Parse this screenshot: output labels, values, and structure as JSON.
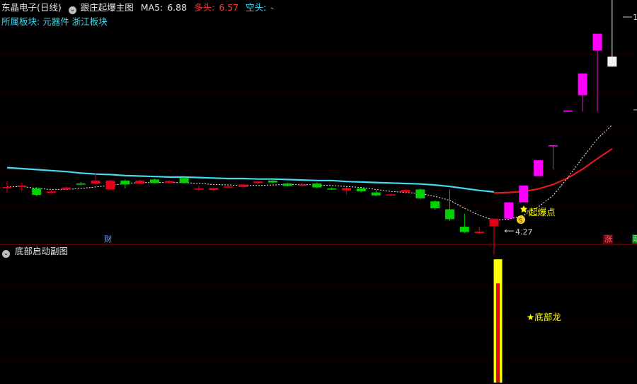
{
  "header": {
    "stock_name": "东晶电子(日线)",
    "indicator_name": "跟庄起爆主图",
    "ma5_label": "MA5:",
    "ma5_value": "6.88",
    "bull_label": "多头:",
    "bull_value": "6.57",
    "bear_label": "空头:",
    "bear_value": "-",
    "sector_label": "所属板块:",
    "sectors": "元器件 浙江板块"
  },
  "sub_panel": {
    "title": "底部启动副图",
    "signal_label": "★底部龙"
  },
  "markers": {
    "cai": "财",
    "zhang": "涨",
    "edge": "融",
    "low_price": "4.27",
    "qibao_label": "起爆点",
    "qibao_icon": "S",
    "top_price": "1"
  },
  "colors": {
    "up": "#e4001c",
    "down": "#00d200",
    "boom": "#ff00ff",
    "cyan_line": "#44d9ec",
    "red_line": "#e31919",
    "grid": "#5a0000",
    "text_white": "#e6e6e6",
    "text_red": "#ff3232",
    "text_cyan": "#3cdcf0",
    "text_yellow": "#ffff00"
  },
  "chart_data": {
    "type": "candlestick",
    "title": "跟庄起爆主图",
    "candles": [
      {
        "o": 5.62,
        "h": 5.75,
        "l": 5.52,
        "c": 5.63,
        "kind": "up"
      },
      {
        "o": 5.66,
        "h": 5.72,
        "l": 5.55,
        "c": 5.63,
        "kind": "up"
      },
      {
        "o": 5.6,
        "h": 5.63,
        "l": 5.44,
        "c": 5.47,
        "kind": "down"
      },
      {
        "o": 5.54,
        "h": 5.57,
        "l": 5.5,
        "c": 5.51,
        "kind": "up"
      },
      {
        "o": 5.58,
        "h": 5.64,
        "l": 5.56,
        "c": 5.62,
        "kind": "up"
      },
      {
        "o": 5.7,
        "h": 5.73,
        "l": 5.66,
        "c": 5.69,
        "kind": "down"
      },
      {
        "o": 5.7,
        "h": 5.9,
        "l": 5.68,
        "c": 5.76,
        "kind": "up"
      },
      {
        "o": 5.58,
        "h": 5.78,
        "l": 5.56,
        "c": 5.76,
        "kind": "up"
      },
      {
        "o": 5.76,
        "h": 5.78,
        "l": 5.6,
        "c": 5.68,
        "kind": "down"
      },
      {
        "o": 5.7,
        "h": 5.78,
        "l": 5.69,
        "c": 5.76,
        "kind": "up"
      },
      {
        "o": 5.78,
        "h": 5.8,
        "l": 5.7,
        "c": 5.71,
        "kind": "down"
      },
      {
        "o": 5.71,
        "h": 5.76,
        "l": 5.7,
        "c": 5.75,
        "kind": "up"
      },
      {
        "o": 5.81,
        "h": 5.83,
        "l": 5.7,
        "c": 5.71,
        "kind": "down"
      },
      {
        "o": 5.6,
        "h": 5.65,
        "l": 5.55,
        "c": 5.6,
        "kind": "up"
      },
      {
        "o": 5.57,
        "h": 5.61,
        "l": 5.54,
        "c": 5.61,
        "kind": "up"
      },
      {
        "o": 5.62,
        "h": 5.67,
        "l": 5.61,
        "c": 5.64,
        "kind": "up"
      },
      {
        "o": 5.63,
        "h": 5.68,
        "l": 5.62,
        "c": 5.68,
        "kind": "up"
      },
      {
        "o": 5.74,
        "h": 5.76,
        "l": 5.69,
        "c": 5.71,
        "kind": "up"
      },
      {
        "o": 5.76,
        "h": 5.77,
        "l": 5.7,
        "c": 5.72,
        "kind": "down"
      },
      {
        "o": 5.7,
        "h": 5.72,
        "l": 5.64,
        "c": 5.65,
        "kind": "down"
      },
      {
        "o": 5.68,
        "h": 5.71,
        "l": 5.64,
        "c": 5.68,
        "kind": "up"
      },
      {
        "o": 5.7,
        "h": 5.72,
        "l": 5.6,
        "c": 5.62,
        "kind": "down"
      },
      {
        "o": 5.6,
        "h": 5.62,
        "l": 5.57,
        "c": 5.59,
        "kind": "down"
      },
      {
        "o": 5.61,
        "h": 5.63,
        "l": 5.48,
        "c": 5.56,
        "kind": "up"
      },
      {
        "o": 5.6,
        "h": 5.62,
        "l": 5.52,
        "c": 5.54,
        "kind": "down"
      },
      {
        "o": 5.52,
        "h": 5.57,
        "l": 5.44,
        "c": 5.46,
        "kind": "down"
      },
      {
        "o": 5.47,
        "h": 5.5,
        "l": 5.44,
        "c": 5.48,
        "kind": "up"
      },
      {
        "o": 5.57,
        "h": 5.58,
        "l": 5.5,
        "c": 5.53,
        "kind": "up"
      },
      {
        "o": 5.58,
        "h": 5.6,
        "l": 5.38,
        "c": 5.4,
        "kind": "down"
      },
      {
        "o": 5.34,
        "h": 5.36,
        "l": 5.17,
        "c": 5.2,
        "kind": "down"
      },
      {
        "o": 5.18,
        "h": 5.58,
        "l": 4.95,
        "c": 4.98,
        "kind": "down"
      },
      {
        "o": 4.83,
        "h": 5.09,
        "l": 4.7,
        "c": 4.72,
        "kind": "down"
      },
      {
        "o": 4.7,
        "h": 4.83,
        "l": 4.68,
        "c": 4.73,
        "kind": "up"
      },
      {
        "o": 4.84,
        "h": 4.97,
        "l": 4.27,
        "c": 4.99,
        "kind": "up"
      },
      {
        "o": 4.99,
        "h": 5.32,
        "l": 4.99,
        "c": 5.32,
        "kind": "boom"
      },
      {
        "o": 5.32,
        "h": 5.66,
        "l": 5.32,
        "c": 5.66,
        "kind": "boom"
      },
      {
        "o": 5.85,
        "h": 6.17,
        "l": 5.85,
        "c": 6.17,
        "kind": "boom"
      },
      {
        "o": 6.47,
        "h": 6.47,
        "l": 5.99,
        "c": 6.47,
        "kind": "boom"
      },
      {
        "o": 7.15,
        "h": 7.17,
        "l": 7.15,
        "c": 7.17,
        "kind": "boom"
      },
      {
        "o": 7.48,
        "h": 7.92,
        "l": 7.15,
        "c": 7.92,
        "kind": "boom"
      },
      {
        "o": 8.38,
        "h": 8.72,
        "l": 7.15,
        "c": 8.72,
        "kind": "boom"
      },
      {
        "o": 8.06,
        "h": 9.55,
        "l": 8.06,
        "c": 8.26,
        "kind": "white"
      }
    ],
    "ma5": [
      5.63,
      5.64,
      5.6,
      5.58,
      5.58,
      5.6,
      5.63,
      5.66,
      5.7,
      5.72,
      5.72,
      5.72,
      5.72,
      5.7,
      5.68,
      5.67,
      5.66,
      5.66,
      5.67,
      5.68,
      5.68,
      5.67,
      5.66,
      5.64,
      5.62,
      5.58,
      5.54,
      5.52,
      5.5,
      5.44,
      5.36,
      5.2,
      5.06,
      4.96,
      4.98,
      5.06,
      5.23,
      5.46,
      5.82,
      6.22,
      6.6,
      6.88
    ],
    "cyan_line": [
      6.02,
      6.0,
      5.98,
      5.96,
      5.94,
      5.91,
      5.89,
      5.88,
      5.86,
      5.85,
      5.84,
      5.83,
      5.83,
      5.82,
      5.81,
      5.8,
      5.8,
      5.79,
      5.79,
      5.78,
      5.77,
      5.76,
      5.76,
      5.74,
      5.73,
      5.72,
      5.71,
      5.7,
      5.69,
      5.67,
      5.64,
      5.6,
      5.56,
      5.53
    ],
    "red_line": [
      5.51,
      5.52,
      5.54,
      5.59,
      5.68,
      5.81,
      5.99,
      6.2,
      6.4
    ],
    "sub_bar": {
      "index": 33,
      "signal": "★底部龙"
    }
  }
}
